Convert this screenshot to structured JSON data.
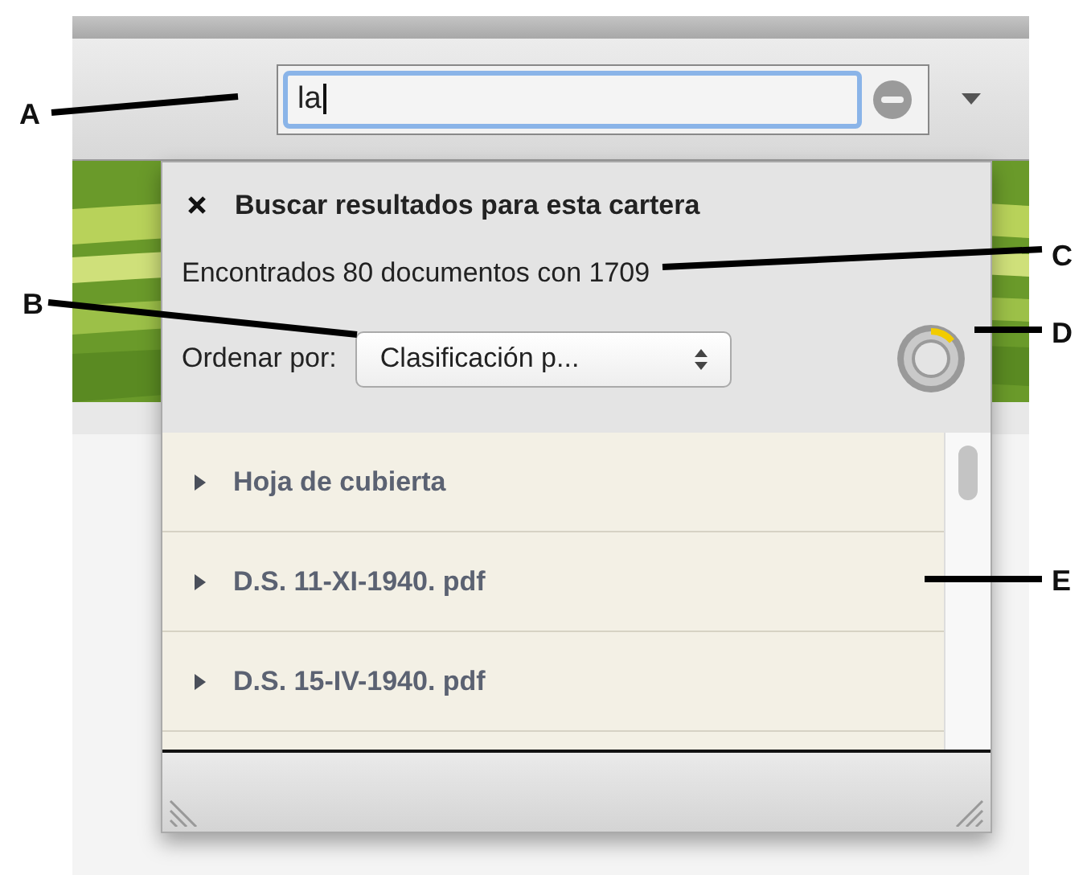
{
  "callouts": [
    {
      "label": "A"
    },
    {
      "label": "B"
    },
    {
      "label": "C"
    },
    {
      "label": "D"
    },
    {
      "label": "E"
    }
  ],
  "search": {
    "value": "la"
  },
  "panel": {
    "title": "Buscar resultados para esta cartera",
    "summary": "Encontrados 80 documentos con 1709",
    "sort_label": "Ordenar por:",
    "sort_value": "Clasificación p..."
  },
  "results": [
    {
      "name": "Hoja de cubierta",
      "expanded": false
    },
    {
      "name": "D.S. 11-XI-1940. pdf",
      "expanded": false
    },
    {
      "name": "D.S. 15-IV-1940. pdf",
      "expanded": false
    }
  ]
}
